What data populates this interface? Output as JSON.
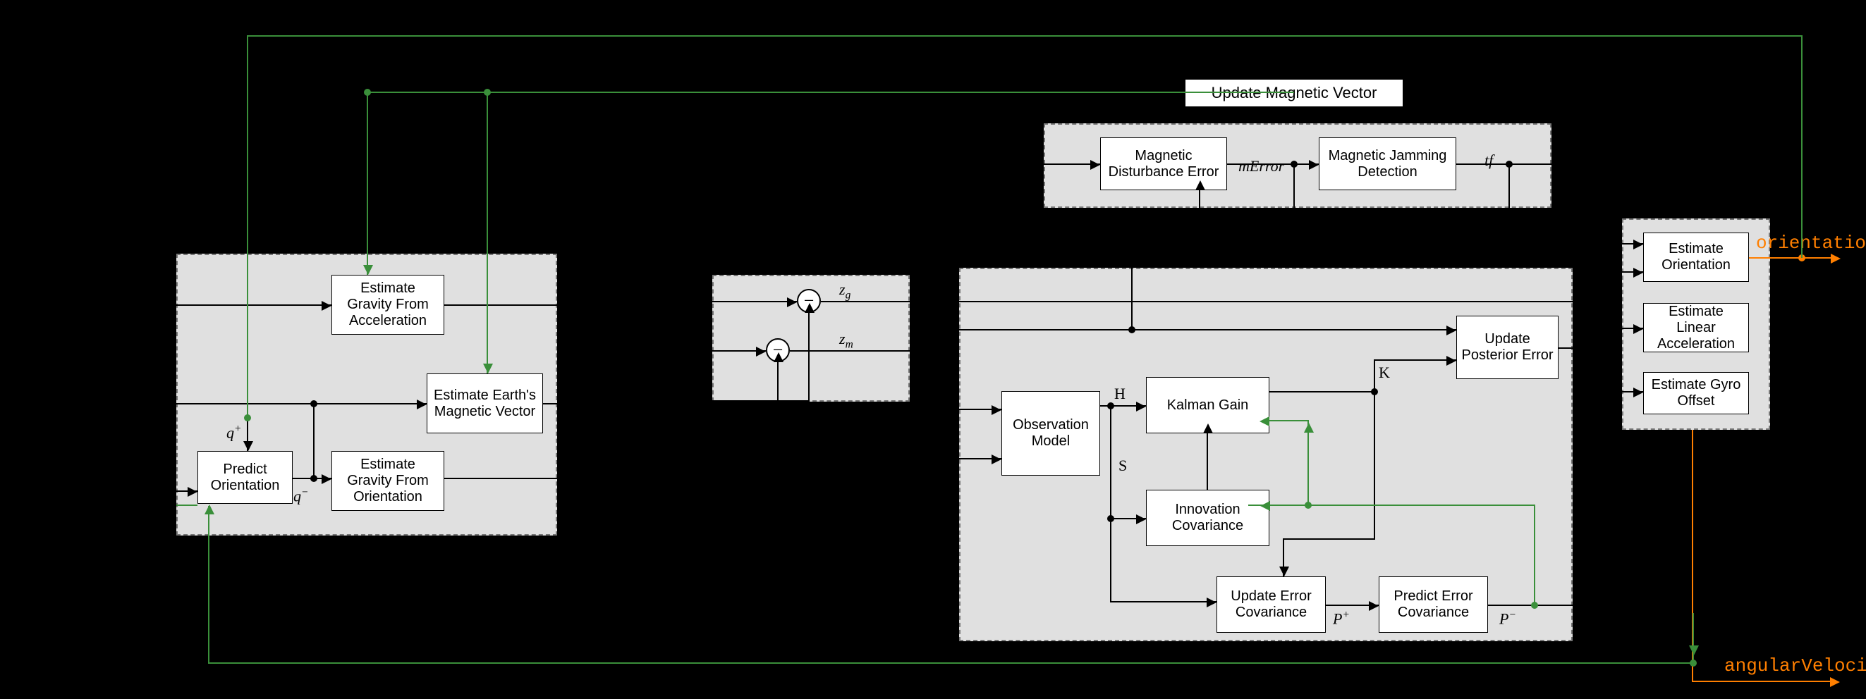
{
  "titles": {
    "update_magnetic_vector": "Update Magnetic Vector"
  },
  "groups": {
    "model": {
      "predict_orientation": "Predict Orientation",
      "est_gravity_from_accel": "Estimate Gravity From Acceleration",
      "est_earth_mag_vec": "Estimate Earth's Magnetic Vector",
      "est_gravity_from_orient": "Estimate Gravity From Orientation"
    },
    "magnetic": {
      "mag_disturb_error": "Magnetic Disturbance Error",
      "mag_jam_detect": "Magnetic Jamming Detection"
    },
    "kalman": {
      "observation_model": "Observation Model",
      "kalman_gain": "Kalman Gain",
      "innovation_cov": "Innovation Covariance",
      "update_post_error": "Update Posterior Error",
      "update_err_cov": "Update Error Covariance",
      "predict_err_cov": "Predict Error Covariance"
    },
    "outputs": {
      "est_orientation": "Estimate Orientation",
      "est_linear_accel": "Estimate Linear Acceleration",
      "est_gyro_offset": "Estimate Gyro Offset"
    }
  },
  "symbols": {
    "q_plus": "q",
    "q_minus": "q",
    "z_g": "z",
    "z_m": "z",
    "mError": "mError",
    "tf": "tf",
    "H": "H",
    "K": "K",
    "S": "S",
    "P_plus": "P",
    "P_minus": "P",
    "plus_sup": "+",
    "minus_sup": "−",
    "g_sub": "g",
    "m_sub": "m",
    "minus": "−"
  },
  "out_labels": {
    "orientation": "orientation",
    "angular_velocity": "angularVelocity"
  },
  "colors": {
    "accent_green": "#3a8f3a",
    "accent_orange": "#ff7f00",
    "group_bg": "#e0e0e0"
  }
}
